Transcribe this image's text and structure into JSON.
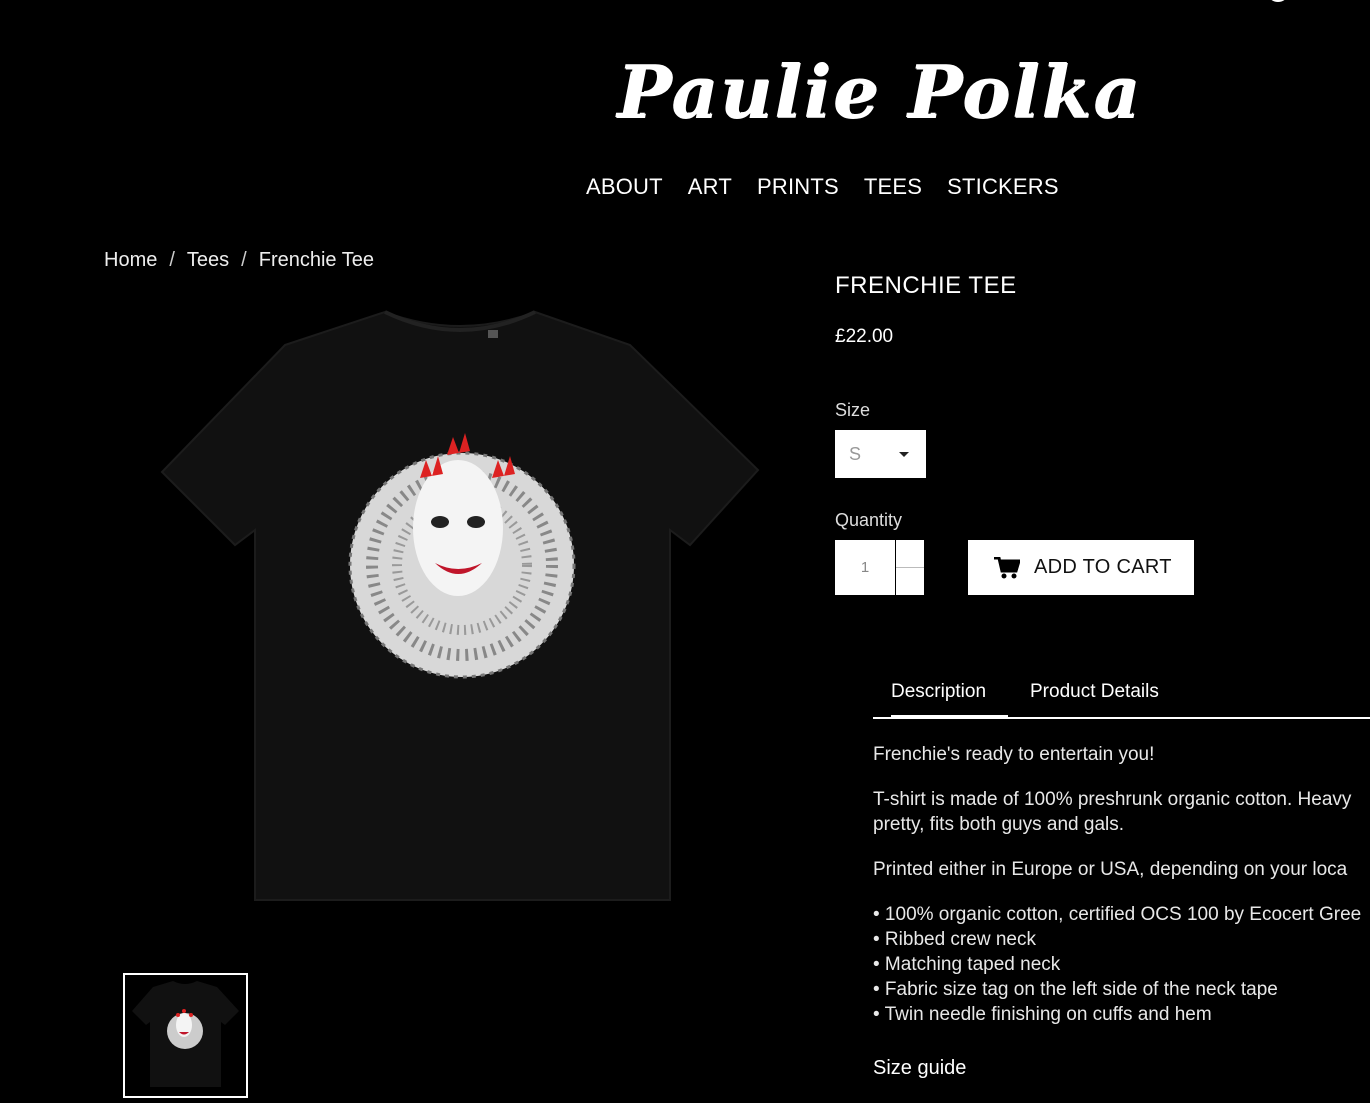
{
  "site": {
    "logo": "Paulie Polka"
  },
  "nav": [
    "ABOUT",
    "ART",
    "PRINTS",
    "TEES",
    "STICKERS"
  ],
  "breadcrumb": {
    "home": "Home",
    "category": "Tees",
    "current": "Frenchie Tee",
    "sep": "/"
  },
  "product": {
    "title": "FRENCHIE TEE",
    "price": "£22.00",
    "size_label": "Size",
    "size_value": "S",
    "quantity_label": "Quantity",
    "quantity_value": "1",
    "add_to_cart": "ADD TO CART"
  },
  "tabs": {
    "description": "Description",
    "details": "Product Details"
  },
  "description": {
    "p1": "Frenchie's ready to entertain you!",
    "p2a": "T-shirt is made of 100% preshrunk organic cotton. Heavy",
    "p2b": "pretty, fits both guys and gals.",
    "p3": "Printed either in Europe or USA, depending on your loca",
    "bullets": [
      "• 100% organic cotton, certified OCS 100 by Ecocert Gree",
      "• Ribbed crew neck",
      "• Matching taped neck",
      "• Fabric size tag on the left side of the neck tape",
      "• Twin needle finishing on cuffs and hem"
    ],
    "size_guide": "Size guide"
  },
  "icons": {
    "cart": "cart-icon",
    "caret": "chevron-down-icon"
  }
}
